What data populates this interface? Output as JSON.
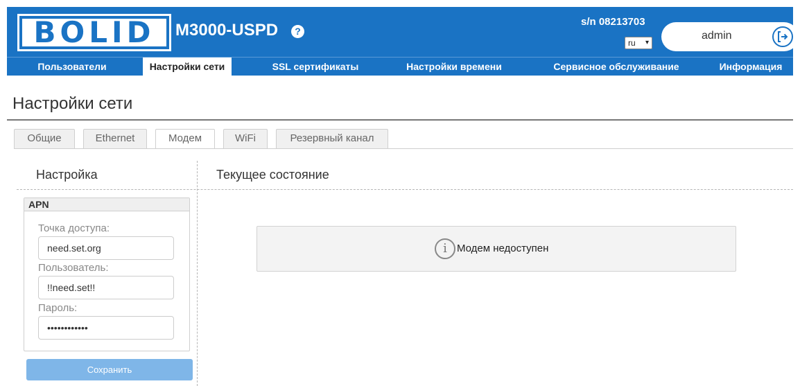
{
  "header": {
    "logo_text": "BOLID",
    "device_name": "M3000-USPD",
    "help_icon": "?",
    "serial": "s/n 08213703",
    "language": "ru",
    "user": "admin",
    "brand_color": "#1a73c4"
  },
  "nav": {
    "items": [
      {
        "label": "Пользователи"
      },
      {
        "label": "Настройки сети",
        "active": true
      },
      {
        "label": "SSL сертификаты"
      },
      {
        "label": "Настройки времени"
      },
      {
        "label": "Сервисное обслуживание"
      },
      {
        "label": "Информация"
      }
    ]
  },
  "page": {
    "title": "Настройки сети"
  },
  "tabs": [
    {
      "label": "Общие"
    },
    {
      "label": "Ethernet"
    },
    {
      "label": "Модем",
      "active": true
    },
    {
      "label": "WiFi"
    },
    {
      "label": "Резервный канал"
    }
  ],
  "settings": {
    "heading": "Настройка",
    "apn": {
      "legend": "APN",
      "access_point_label": "Точка доступа:",
      "access_point_value": "need.set.org",
      "user_label": "Пользователь:",
      "user_value": "!!need.set!!",
      "password_label": "Пароль:",
      "password_value": "••••••••••••"
    },
    "save_label": "Сохранить"
  },
  "status": {
    "heading": "Текущее состояние",
    "info_icon": "i",
    "message": "Модем недоступен"
  }
}
